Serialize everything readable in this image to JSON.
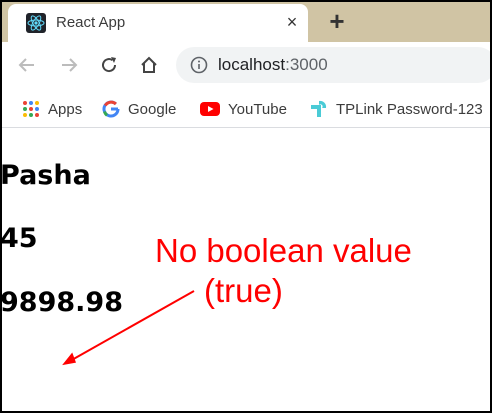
{
  "browser": {
    "tab": {
      "title": "React App",
      "close_glyph": "×",
      "favicon": "react-logo-icon"
    },
    "new_tab_glyph": "+",
    "url": {
      "host": "localhost",
      "port": ":3000"
    },
    "bookmarks": [
      {
        "label": "Apps",
        "icon": "apps-grid-icon"
      },
      {
        "label": "Google",
        "icon": "google-g-icon"
      },
      {
        "label": "YouTube",
        "icon": "youtube-icon"
      },
      {
        "label": "TPLink Password-123",
        "icon": "tplink-icon"
      }
    ]
  },
  "page": {
    "fields": [
      "Pasha",
      "45",
      "9898.98"
    ]
  },
  "annotation": {
    "line1": "No boolean value",
    "line2": "(true)",
    "color": "#ff0000"
  },
  "colors": {
    "tabstrip": "#d0c4a4",
    "omnibox": "#f1f3f4",
    "annotation": "#ff0000"
  }
}
